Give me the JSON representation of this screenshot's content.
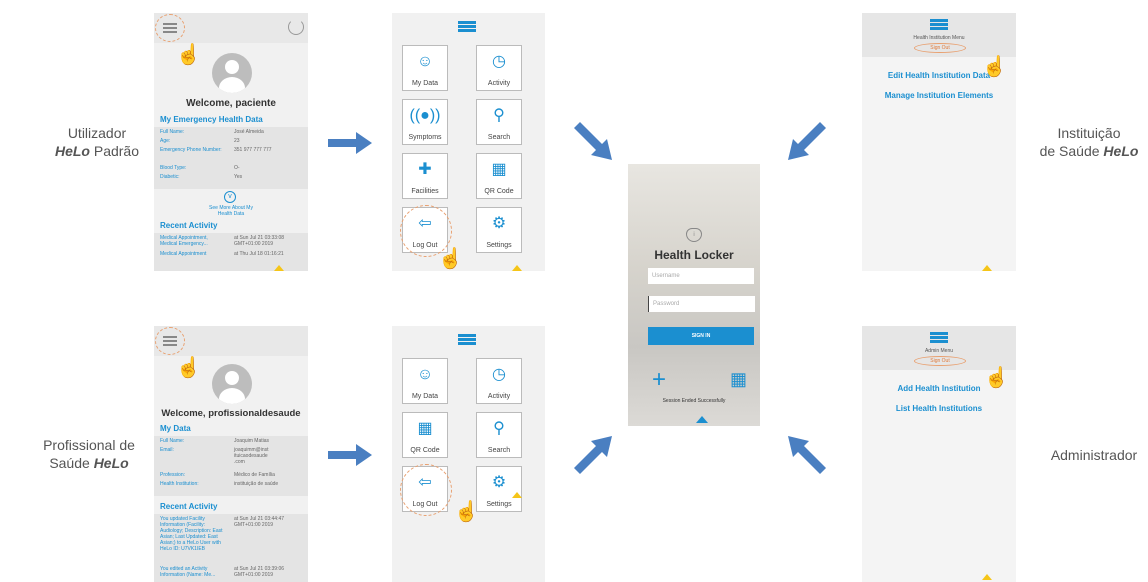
{
  "row_labels": {
    "user_line1": "Utilizador",
    "user_italic": "HeLo",
    "user_rest": " Padrão",
    "prof_line1": "Profissional de",
    "prof_line2a": "Saúde ",
    "prof_italic": "HeLo",
    "inst_line1": "Instituição",
    "inst_line2a": "de Saúde ",
    "inst_italic": "HeLo",
    "admin": "Administrador"
  },
  "patient_home": {
    "welcome": "Welcome, paciente",
    "section": "My Emergency Health Data",
    "fields": [
      {
        "k": "Full Name:",
        "v": "José Almeida"
      },
      {
        "k": "Age:",
        "v": "23"
      },
      {
        "k": "Emergency Phone Number:",
        "v": "351 977 777 777"
      },
      {
        "k": "Blood Type:",
        "v": "O-"
      },
      {
        "k": "Diabetic:",
        "v": "Yes"
      }
    ],
    "see_more": "See More About My Health Data",
    "recent": "Recent Activity",
    "activity": [
      {
        "k": "Medical Appointment, Medical Emergency...",
        "v": "at Sun Jul 21 03:33:08 GMT+01:00 2019"
      },
      {
        "k": "Medical Appointment",
        "v": "at Thu Jul 18 01:16:21"
      }
    ]
  },
  "prof_home": {
    "welcome": "Welcome, profissionaldesaude",
    "section": "My Data",
    "fields": [
      {
        "k": "Full Name:",
        "v": "Joaquim Matias"
      },
      {
        "k": "Email:",
        "v": "joaquimm@inst ituicaodesaude .com"
      },
      {
        "k": "Profession:",
        "v": "Médico de Família"
      },
      {
        "k": "Health Institution:",
        "v": "instituição de saúde"
      }
    ],
    "recent": "Recent Activity",
    "activity": [
      {
        "k": "You updated Facility Information (Facility: Audiology; Description: East Asian; Last Updated: East Asian;) to a HeLo User with HeLo ID: U7VK1IEB",
        "v": "at Sun Jul 21 03:44:47 GMT+01:00 2019"
      },
      {
        "k": "You edited an Activity Information (Name: Me...",
        "v": "at Sun Jul 21 03:39:06 GMT+01:00 2019"
      }
    ]
  },
  "patient_menu": {
    "tiles": [
      "My Data",
      "Activity",
      "Symptoms",
      "Search",
      "Facilities",
      "QR Code",
      "Log Out",
      "Settings"
    ]
  },
  "prof_menu": {
    "tiles": [
      "My Data",
      "Activity",
      "QR Code",
      "Search",
      "Log Out",
      "Settings"
    ]
  },
  "login": {
    "title": "Health Locker",
    "username_placeholder": "Username",
    "password_placeholder": "Password",
    "sign_in": "SIGN IN",
    "session_msg": "Session Ended Successfully"
  },
  "inst_menu": {
    "title": "Health Institution Menu",
    "sign_out": "Sign Out",
    "links": [
      "Edit Health Institution Data",
      "Manage Institution Elements"
    ]
  },
  "admin_menu": {
    "title": "Admin Menu",
    "sign_out": "Sign Out",
    "links": [
      "Add Health Institution",
      "List Health Institutions"
    ]
  },
  "colors": {
    "accent": "#1b8fd0",
    "arrow": "#4a7fc1",
    "highlight": "#e8a070",
    "triangle": "#f5c518"
  }
}
